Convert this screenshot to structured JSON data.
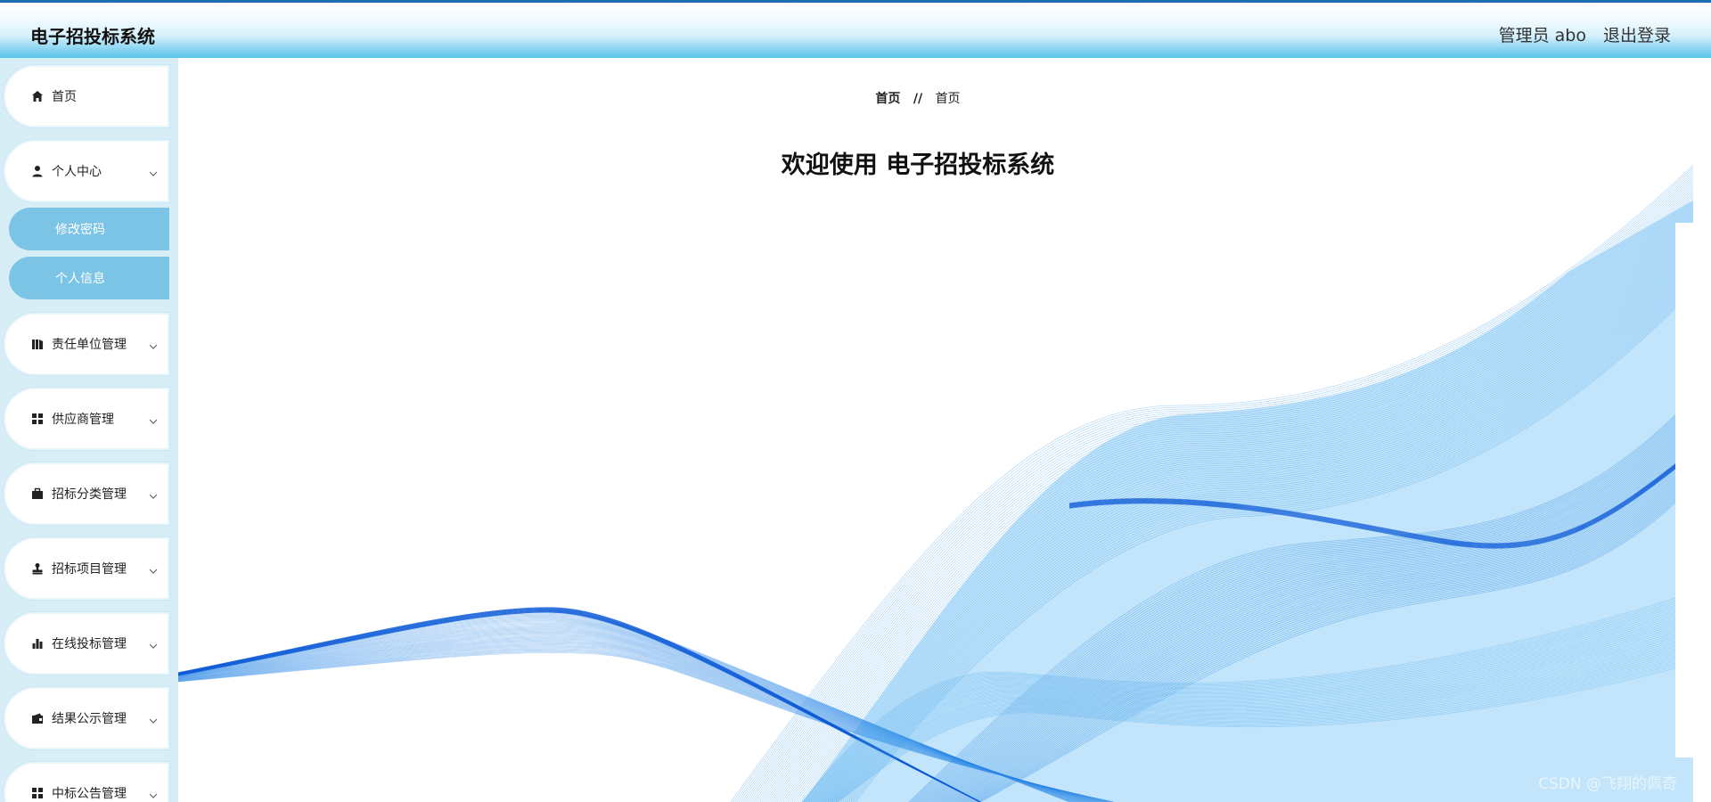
{
  "header": {
    "title": "电子招投标系统",
    "user_label": "管理员 abo",
    "logout_label": "退出登录"
  },
  "sidebar": {
    "items": [
      {
        "label": "首页",
        "icon": "home-icon"
      },
      {
        "label": "个人中心",
        "icon": "user-icon",
        "expanded": true
      },
      {
        "label": "责任单位管理",
        "icon": "building-icon"
      },
      {
        "label": "供应商管理",
        "icon": "grid-icon"
      },
      {
        "label": "招标分类管理",
        "icon": "briefcase-icon"
      },
      {
        "label": "招标项目管理",
        "icon": "stamp-icon"
      },
      {
        "label": "在线投标管理",
        "icon": "bar-chart-icon"
      },
      {
        "label": "结果公示管理",
        "icon": "wallet-icon"
      },
      {
        "label": "中标公告管理",
        "icon": "grid-icon"
      }
    ],
    "subitems": [
      {
        "label": "修改密码"
      },
      {
        "label": "个人信息"
      }
    ]
  },
  "main": {
    "breadcrumb": {
      "root": "首页",
      "separator": "//",
      "current": "首页"
    },
    "welcome": "欢迎使用 电子招投标系统"
  },
  "watermark": "CSDN @飞翔的佩奇",
  "colors": {
    "header_accent": "#1f6fb0",
    "submenu_bg": "#7cc4e6",
    "sidebar_bg": "#d7eef7",
    "wave_blue": "#2f8fe6"
  }
}
